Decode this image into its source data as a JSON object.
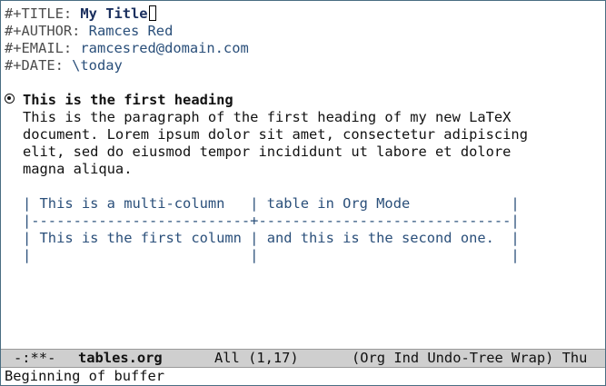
{
  "buffer": {
    "keywords": {
      "title": {
        "key": "#+TITLE: ",
        "value": "My Title"
      },
      "author": {
        "key": "#+AUTHOR: ",
        "value": "Ramces Red"
      },
      "email": {
        "key": "#+EMAIL: ",
        "value": "ramcesred@domain.com"
      },
      "date": {
        "key": "#+DATE: ",
        "value": "\\today"
      }
    },
    "heading": "This is the first heading",
    "paragraph_lines": [
      "This is the paragraph of the first heading of my new LaTeX",
      "document. Lorem ipsum dolor sit amet, consectetur adipiscing",
      "elit, sed do eiusmod tempor incididunt ut labore et dolore",
      "magna aliqua."
    ],
    "table_lines": [
      "| This is a multi-column   | table in Org Mode            |",
      "|--------------------------+------------------------------|",
      "| This is the first column | and this is the second one.  |",
      "|                          |                              |"
    ]
  },
  "modeline": {
    "status": "-:**-",
    "buffer_name": "tables.org",
    "position": "All (1,17)",
    "modes": "(Org Ind Undo-Tree Wrap) Thu"
  },
  "echo_area": "Beginning of buffer"
}
